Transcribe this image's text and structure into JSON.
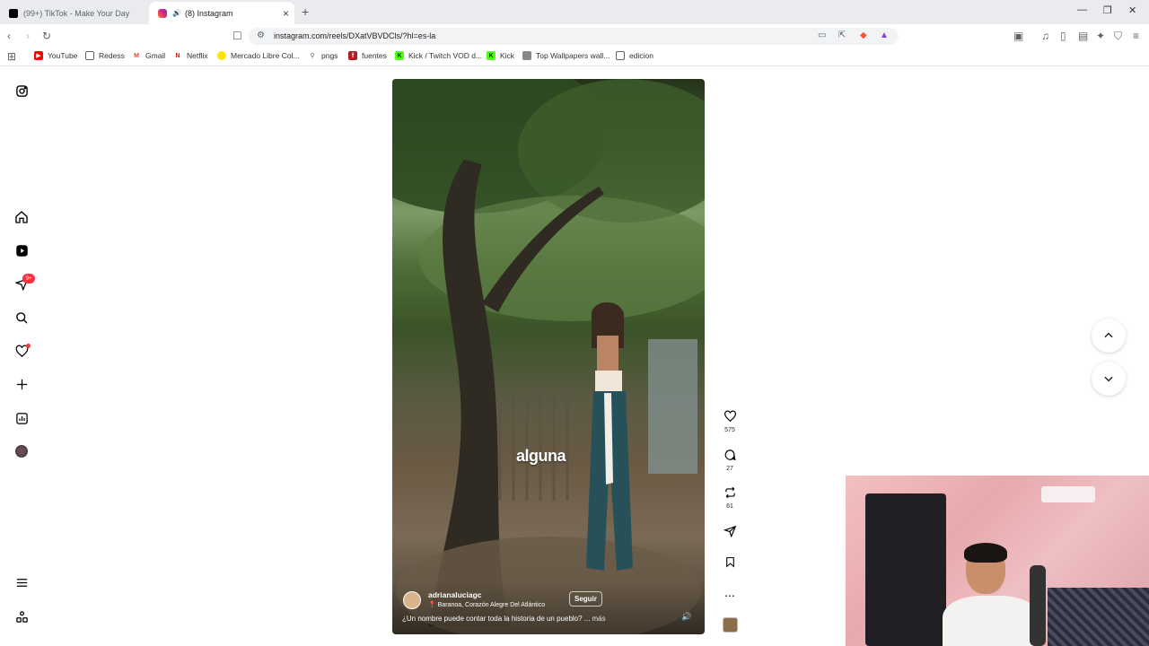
{
  "browser": {
    "tabs": [
      {
        "title": "(99+) TikTok - Make Your Day",
        "active": false
      },
      {
        "title": "(8) Instagram",
        "active": true
      }
    ],
    "new_tab": "+",
    "url": "instagram.com/reels/DXatVBVDCls/?hl=es-la",
    "bookmarks": [
      {
        "label": "YouTube",
        "icon": "youtube-icon",
        "color": "#ff0000"
      },
      {
        "label": "Redess",
        "icon": "folder-icon",
        "color": "#5f6368"
      },
      {
        "label": "Gmail",
        "icon": "gmail-icon",
        "color": "#ea4335"
      },
      {
        "label": "Netflix",
        "icon": "netflix-icon",
        "color": "#e50914"
      },
      {
        "label": "Mercado Libre Col...",
        "icon": "mercadolibre-icon",
        "color": "#ffe600"
      },
      {
        "label": "pngs",
        "icon": "pin-icon",
        "color": "#5f6368"
      },
      {
        "label": "fuentes",
        "icon": "fuentes-icon",
        "color": "#b51f24"
      },
      {
        "label": "Kick / Twitch VOD d...",
        "icon": "kick-icon",
        "color": "#53fc18"
      },
      {
        "label": "Kick",
        "icon": "kick-icon",
        "color": "#53fc18"
      },
      {
        "label": "Top Wallpapers wall...",
        "icon": "wallpaper-icon",
        "color": "#888888"
      },
      {
        "label": "edicion",
        "icon": "folder-icon",
        "color": "#5f6368"
      }
    ]
  },
  "sidebar": {
    "notifications_badge": "9+"
  },
  "reel": {
    "overlay_text": "alguna",
    "username": "adrianaluciagc",
    "location": "Baranoa, Corazón Alegre Del Atlántico",
    "follow_label": "Seguir",
    "caption": "¿Un nombre puede contar toda la historia de un pueblo? ...",
    "more_label": "más"
  },
  "actions": {
    "likes": "575",
    "comments": "27",
    "reposts": "61",
    "more": "..."
  },
  "colors": {
    "badge": "#ff3040",
    "reel_bg": "#3e5a2a"
  }
}
